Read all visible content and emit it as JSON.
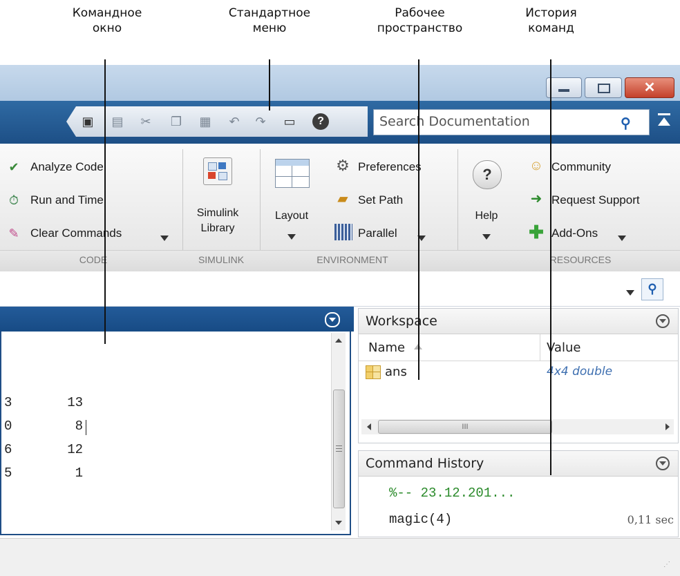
{
  "annotations": {
    "command_window": "Командное\nокно",
    "standard_menu": "Стандартное\nменю",
    "workspace": "Рабочее\nпространство",
    "command_history": "История\nкоманд"
  },
  "window": {
    "controls": [
      "minimize-icon",
      "maximize-icon",
      "close-icon"
    ]
  },
  "toolstrip": {
    "quick_access_icons": [
      "new-icon",
      "save-icon",
      "cut-icon",
      "copy-icon",
      "paste-icon",
      "undo-icon",
      "redo-icon",
      "switch-windows-icon",
      "help-icon"
    ],
    "search_placeholder": "Search Documentation"
  },
  "ribbon": {
    "code": {
      "items": [
        "Analyze Code",
        "Run and Time",
        "Clear Commands"
      ],
      "group_label": "CODE"
    },
    "simulink": {
      "library_line1": "Simulink",
      "library_line2": "Library",
      "group_label": "SIMULINK"
    },
    "environment": {
      "layout_label": "Layout",
      "items": [
        "Preferences",
        "Set Path",
        "Parallel"
      ],
      "group_label": "ENVIRONMENT"
    },
    "help_label": "Help",
    "resources": {
      "items": [
        "Community",
        "Request Support",
        "Add-Ons"
      ],
      "group_label": "RESOURCES"
    }
  },
  "command_window": {
    "lines": [
      {
        "c1": "3",
        "c2": "13"
      },
      {
        "c1": "0",
        "c2": "8"
      },
      {
        "c1": "6",
        "c2": "12"
      },
      {
        "c1": "5",
        "c2": "1"
      }
    ]
  },
  "workspace": {
    "title": "Workspace",
    "columns": {
      "name": "Name",
      "value": "Value"
    },
    "rows": [
      {
        "name": "ans",
        "value": "4x4 double"
      }
    ],
    "hscroll_mark": "III"
  },
  "command_history": {
    "title": "Command History",
    "session": "%-- 23.12.201...",
    "entries": [
      {
        "command": "magic(4)",
        "time": "0,11 sec"
      }
    ]
  },
  "colors": {
    "toolstrip": "#1d4f86",
    "history_session": "#2a8a2a",
    "value_text": "#3e6fb0"
  }
}
